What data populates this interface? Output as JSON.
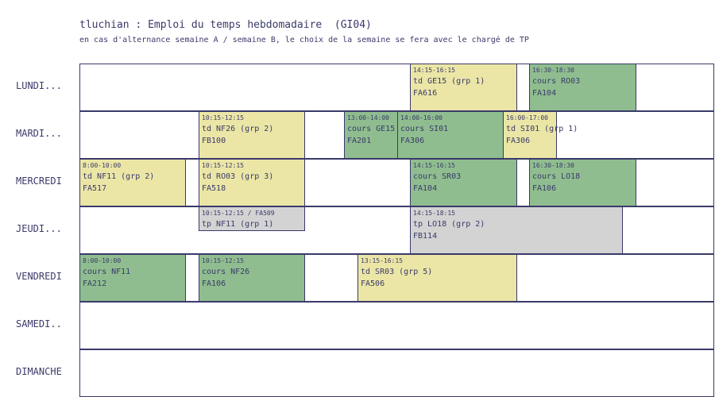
{
  "header": {
    "title": "tluchian : Emploi du temps hebdomadaire  (GI04)",
    "subtitle": "en cas d'alternance semaine A / semaine B, le choix de la semaine se fera avec le chargé de TP"
  },
  "days": [
    "LUNDI...",
    "MARDI...",
    "MERCREDI",
    "JEUDI...",
    "VENDREDI",
    "SAMEDI..",
    "DIMANCHE"
  ],
  "courses": [
    {
      "time": "14:15-16:15",
      "name": "td GE15 (grp 1)",
      "room": "FA616",
      "kind": "td"
    },
    {
      "time": "16:30-18:30",
      "name": "cours RO03",
      "room": "FA104",
      "kind": "cours"
    },
    {
      "time": "10:15-12:15",
      "name": "td NF26 (grp 2)",
      "room": "FB100",
      "kind": "td"
    },
    {
      "time": "13:00-14:00",
      "name": "cours GE15",
      "room": "FA201",
      "kind": "cours"
    },
    {
      "time": "14:00-16:00",
      "name": "cours SI01",
      "room": "FA306",
      "kind": "cours"
    },
    {
      "time": "16:00-17:00",
      "name": "td SI01 (grp 1)",
      "room": "FA306",
      "kind": "td"
    },
    {
      "time": "8:00-10:00",
      "name": "td NF11 (grp 2)",
      "room": "FA517",
      "kind": "td"
    },
    {
      "time": "10:15-12:15",
      "name": "td RO03 (grp 3)",
      "room": "FA518",
      "kind": "td"
    },
    {
      "time": "14:15-16:15",
      "name": "cours SR03",
      "room": "FA104",
      "kind": "cours"
    },
    {
      "time": "16:30-18:30",
      "name": "cours LO18",
      "room": "FA106",
      "kind": "cours"
    },
    {
      "time": "10:15-12:15 / FA509",
      "name": "tp NF11 (grp 1)",
      "room": "",
      "kind": "tp"
    },
    {
      "time": "14:15-18:15",
      "name": "tp LO18 (grp 2)",
      "room": "FB114",
      "kind": "tp"
    },
    {
      "time": "8:00-10:00",
      "name": "cours NF11",
      "room": "FA212",
      "kind": "cours"
    },
    {
      "time": "10:15-12:15",
      "name": "cours NF26",
      "room": "FA106",
      "kind": "cours"
    },
    {
      "time": "13:15-16:15",
      "name": "td SR03 (grp 5)",
      "room": "FA506",
      "kind": "td"
    }
  ]
}
